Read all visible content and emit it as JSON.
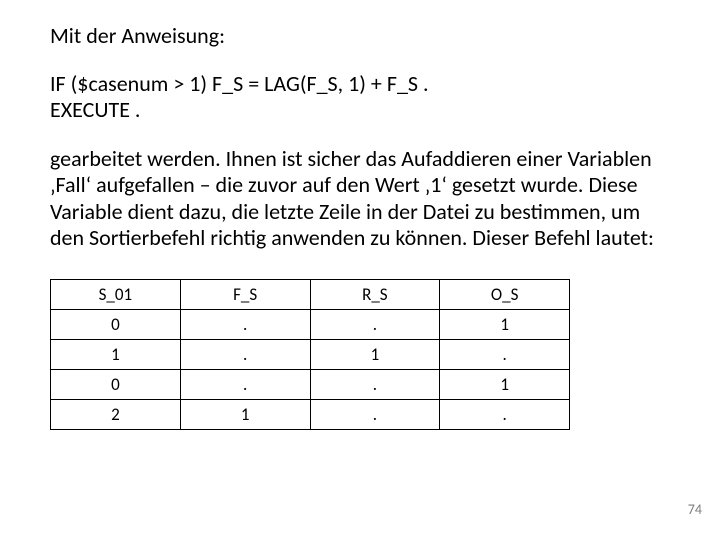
{
  "heading": "Mit der Anweisung:",
  "code": {
    "line1": "IF ($casenum > 1) F_S = LAG(F_S, 1) + F_S .",
    "line2": "EXECUTE ."
  },
  "paragraph": "gearbeitet werden. Ihnen ist sicher das Aufaddieren einer Variablen ‚Fall‘ aufgefallen – die zuvor auf den Wert ‚1‘ gesetzt wurde. Diese Variable dient dazu, die letzte Zeile in der Datei zu bestimmen, um den Sortierbefehl richtig anwenden zu können. Dieser Befehl lautet:",
  "table": {
    "headers": [
      "S_01",
      "F_S",
      "R_S",
      "O_S"
    ],
    "rows": [
      [
        "0",
        ".",
        ".",
        "1"
      ],
      [
        "1",
        ".",
        "1",
        "."
      ],
      [
        "0",
        ".",
        ".",
        "1"
      ],
      [
        "2",
        "1",
        ".",
        "."
      ]
    ]
  },
  "pageNumber": "74"
}
